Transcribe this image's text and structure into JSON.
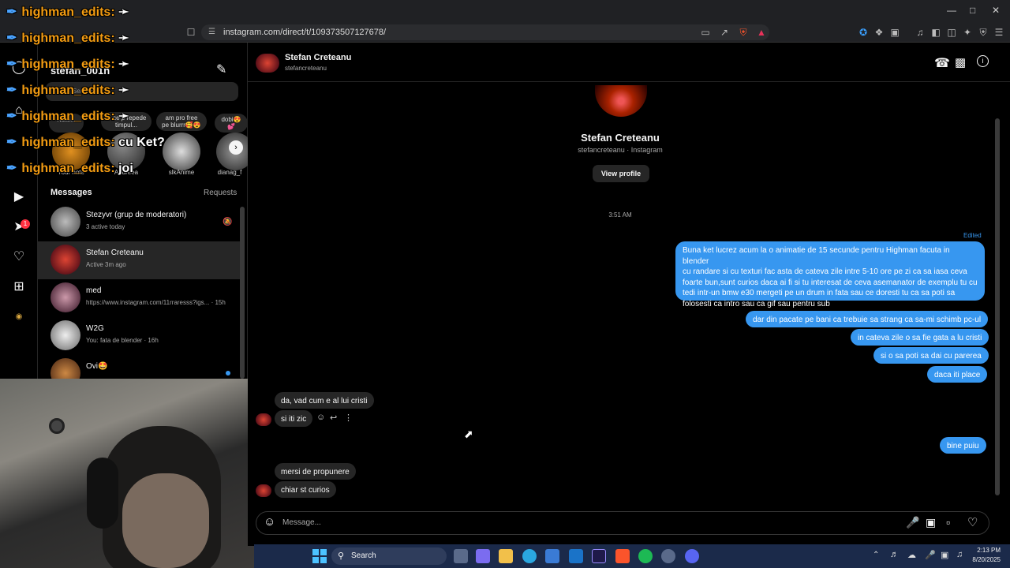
{
  "browser": {
    "url": "instagram.com/direct/t/109373507127678/",
    "window_controls": [
      "minimize",
      "maximize",
      "close"
    ]
  },
  "overlays": [
    {
      "name": "highman_edits:",
      "msg": "",
      "icon": "mute-icon"
    },
    {
      "name": "highman_edits:",
      "msg": "",
      "icon": "mute-icon"
    },
    {
      "name": "highman_edits:",
      "msg": "",
      "icon": "mute-icon"
    },
    {
      "name": "highman_edits:",
      "msg": "",
      "icon": "mute-icon"
    },
    {
      "name": "highman_edits:",
      "msg": "",
      "icon": "mute-icon"
    },
    {
      "name": "highman_edits:",
      "msg": "cu Ket?",
      "icon": ""
    },
    {
      "name": "highman_edits:",
      "msg": "joi",
      "icon": ""
    }
  ],
  "inbox": {
    "username": "stefan_001n",
    "search_placeholder": "Search",
    "notes": [
      {
        "text": "Note..."
      },
      {
        "text": "ai ce p repede timpul..."
      },
      {
        "text": "am pro free pe blurrr🥰😍"
      },
      {
        "text": "dobi😍 💕"
      }
    ],
    "stories": [
      {
        "label": "Your note"
      },
      {
        "label": "Andreea"
      },
      {
        "label": "slkAnime"
      },
      {
        "label": "dianag_f"
      }
    ],
    "messages_heading": "Messages",
    "requests_label": "Requests",
    "conversations": [
      {
        "name": "Stezyvr (grup de moderatori)",
        "sub": "3 active today",
        "muted": true,
        "selected": false
      },
      {
        "name": "Stefan Creteanu",
        "sub": "Active 3m ago",
        "muted": false,
        "selected": true
      },
      {
        "name": "med",
        "sub": "https://www.instagram.com/11rraresss?igs... · 15h",
        "muted": false,
        "selected": false
      },
      {
        "name": "W2G",
        "sub": "You: fata de blender · 16h",
        "muted": false,
        "selected": false
      },
      {
        "name": "Ovi🤩",
        "sub": "",
        "muted": false,
        "selected": false,
        "unread": true
      }
    ],
    "notification_count": "1"
  },
  "chat": {
    "contact_name": "Stefan Creteanu",
    "contact_username": "stefancreteanu",
    "profile_name": "Stefan Creteanu",
    "profile_sub": "stefancreteanu · Instagram",
    "view_profile": "View profile",
    "timestamp": "3:51 AM",
    "edited_label": "Edited",
    "outgoing_1": [
      "Buna ket lucrez acum la o animatie de 15 secunde pentru Highman facuta in blender",
      "cu randare si cu texturi fac asta de cateva zile intre 5-10 ore pe zi ca sa iasa ceva",
      "foarte bun,sunt curios daca ai fi si tu interesat de ceva asemanator de exemplu tu cu",
      "tedi intr-un bmw e30 mergeti pe un drum in fata sau ce doresti tu ca sa poti sa",
      "folosesti ca intro sau ca gif sau pentru sub"
    ],
    "outgoing_2": "dar din pacate pe bani ca trebuie sa strang ca sa-mi schimb pc-ul",
    "outgoing_3": "in cateva zile o sa fie gata a lu cristi",
    "outgoing_4": "si o sa poti sa dai cu parerea",
    "outgoing_5": "daca iti place",
    "incoming_1": "da, vad cum e al lui cristi",
    "incoming_2": "si iti zic",
    "outgoing_6": "bine puiu",
    "incoming_3": "mersi de propunere",
    "incoming_4": "chiar st curios",
    "composer_placeholder": "Message..."
  },
  "taskbar": {
    "search_label": "Search",
    "time": "2:13 PM",
    "date": "8/20/2025"
  },
  "colors": {
    "accent_blue": "#3797f0",
    "bubble_gray": "#262626",
    "overlay_orange": "#f39c12"
  }
}
